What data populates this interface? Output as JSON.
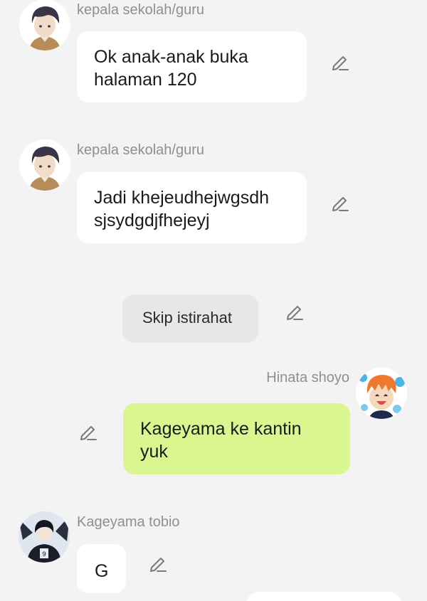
{
  "messages": [
    {
      "sender": "kepala sekolah/guru",
      "text": "Ok anak-anak buka halaman 120",
      "side": "left",
      "avatar_icon": "teacher-avatar"
    },
    {
      "sender": "kepala sekolah/guru",
      "text": "Jadi khejeudhejwgsdh sjsydgdjfhejeyj",
      "side": "left",
      "avatar_icon": "teacher-avatar"
    },
    {
      "sender": "",
      "text": "Skip istirahat",
      "side": "center",
      "avatar_icon": ""
    },
    {
      "sender": "Hinata shoyo",
      "text": "Kageyama ke kantin yuk",
      "side": "right",
      "avatar_icon": "hinata-avatar"
    },
    {
      "sender": "Kageyama tobio",
      "text": "G",
      "side": "left",
      "avatar_icon": "kageyama-avatar"
    }
  ],
  "icons": {
    "edit": "pencil-edit-icon"
  },
  "colors": {
    "background": "#f3f3f3",
    "bubble_white": "#ffffff",
    "bubble_green": "#d9f68f",
    "bubble_gray": "#e7e7e7",
    "sender_text": "#8f8f8f",
    "icon_stroke": "#7a7a7a"
  }
}
